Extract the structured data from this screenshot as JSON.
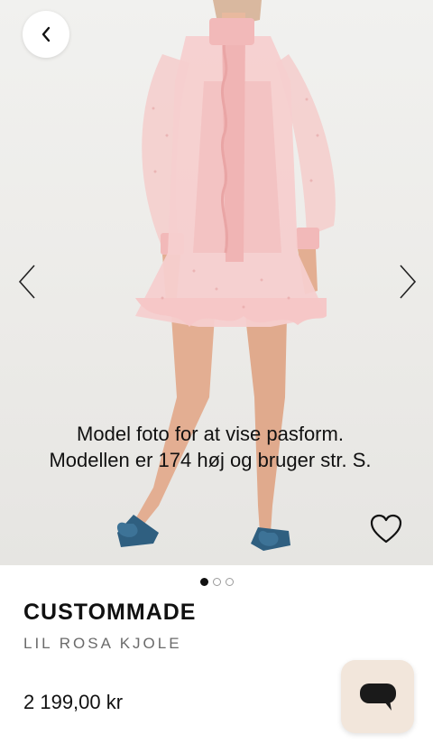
{
  "header": {
    "back_icon": "chevron-left-icon"
  },
  "gallery": {
    "image_description_icon": "product-photo",
    "prev_icon": "chevron-left-icon",
    "next_icon": "chevron-right-icon",
    "caption_line1": "Model foto for at vise pasform.",
    "caption_line2": "Modellen er 174 høj og bruger str. S.",
    "favorite_icon": "heart-icon",
    "total_images": 3,
    "active_index": 0
  },
  "product": {
    "brand": "CUSTOMMADE",
    "name": "LIL ROSA KJOLE",
    "price": "2 199,00 kr"
  },
  "chat": {
    "icon": "chat-bubble-icon",
    "color": "#f2e6db"
  },
  "colors": {
    "dress": "#f6cfcf",
    "shoes": "#2f5f80"
  }
}
